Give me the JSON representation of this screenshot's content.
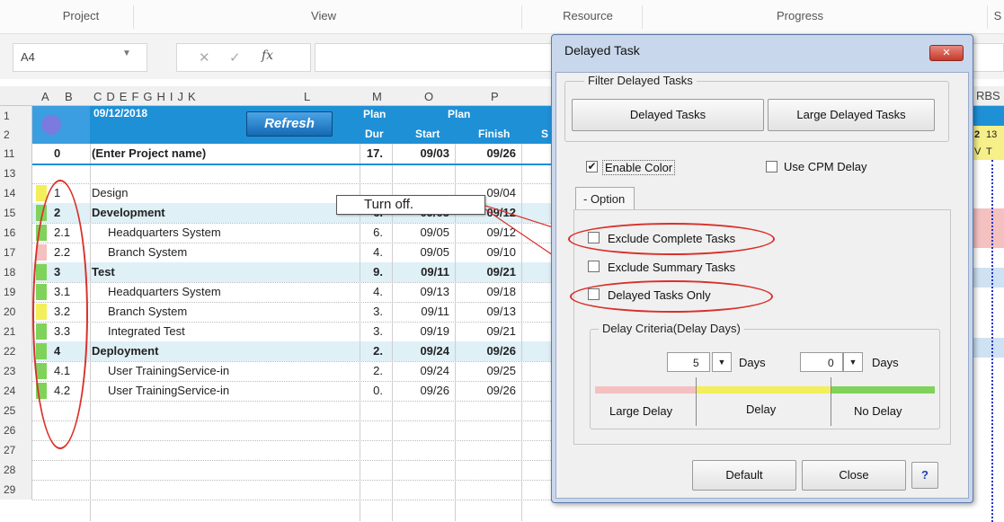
{
  "ribbon": {
    "groups": [
      "Project",
      "View",
      "Resource",
      "Progress",
      "S"
    ]
  },
  "formula_bar": {
    "name_box": "A4",
    "fx": "fx"
  },
  "columns": {
    "letters": [
      "A",
      "B",
      "C",
      "D",
      "E",
      "F",
      "G",
      "H",
      "I",
      "J",
      "K",
      "L",
      "M",
      "O",
      "P"
    ],
    "right": "RBS"
  },
  "header": {
    "date": "09/12/2018",
    "refresh": "Refresh",
    "plan_dur_top": "Plan",
    "plan_dur_bottom": "Dur",
    "plan_label": "Plan",
    "start_label": "Start",
    "finish_label": "Finish",
    "col_s": "S",
    "timeline_day": "2",
    "timeline_day2": "13",
    "timeline_wk": "V",
    "timeline_wk2": "T"
  },
  "rows": [
    {
      "num": "1",
      "task": "",
      "dur": "",
      "start": "",
      "finish": ""
    },
    {
      "num": "2",
      "task": "",
      "dur": "",
      "start": "",
      "finish": ""
    },
    {
      "num": "11",
      "id": "0",
      "task": "(Enter Project name)",
      "dur": "17.",
      "start": "09/03",
      "finish": "09/26",
      "bold": true
    },
    {
      "num": "13",
      "id": "",
      "task": "",
      "dur": "",
      "start": "",
      "finish": ""
    },
    {
      "num": "14",
      "id": "1",
      "task": "Design",
      "dur": "",
      "start": "",
      "finish": "09/04",
      "status": "yellow"
    },
    {
      "num": "15",
      "id": "2",
      "task": "Development",
      "dur": "6.",
      "start": "09/05",
      "finish": "09/12",
      "bold": true,
      "status": "green"
    },
    {
      "num": "16",
      "id": "2.1",
      "task": "Headquarters System",
      "dur": "6.",
      "start": "09/05",
      "finish": "09/12",
      "indent": true,
      "status": "green"
    },
    {
      "num": "17",
      "id": "2.2",
      "task": "Branch System",
      "dur": "4.",
      "start": "09/05",
      "finish": "09/10",
      "indent": true,
      "status": "pink"
    },
    {
      "num": "18",
      "id": "3",
      "task": "Test",
      "dur": "9.",
      "start": "09/11",
      "finish": "09/21",
      "bold": true,
      "status": "green"
    },
    {
      "num": "19",
      "id": "3.1",
      "task": "Headquarters System",
      "dur": "4.",
      "start": "09/13",
      "finish": "09/18",
      "indent": true,
      "status": "green"
    },
    {
      "num": "20",
      "id": "3.2",
      "task": "Branch System",
      "dur": "3.",
      "start": "09/11",
      "finish": "09/13",
      "indent": true,
      "status": "yellow"
    },
    {
      "num": "21",
      "id": "3.3",
      "task": "Integrated Test",
      "dur": "3.",
      "start": "09/19",
      "finish": "09/21",
      "indent": true,
      "status": "green"
    },
    {
      "num": "22",
      "id": "4",
      "task": "Deployment",
      "dur": "2.",
      "start": "09/24",
      "finish": "09/26",
      "bold": true,
      "status": "green"
    },
    {
      "num": "23",
      "id": "4.1",
      "task": "User TrainingService-in",
      "dur": "2.",
      "start": "09/24",
      "finish": "09/25",
      "indent": true,
      "status": "green"
    },
    {
      "num": "24",
      "id": "4.2",
      "task": "User TrainingService-in",
      "dur": "0.",
      "start": "09/26",
      "finish": "09/26",
      "indent": true,
      "status": "green"
    },
    {
      "num": "25"
    },
    {
      "num": "26"
    },
    {
      "num": "27"
    },
    {
      "num": "28"
    },
    {
      "num": "29"
    }
  ],
  "callout": {
    "text": "Turn off."
  },
  "dialog": {
    "title": "Delayed Task",
    "close_x": "✕",
    "filter_legend": "Filter Delayed Tasks",
    "btn_delayed": "Delayed Tasks",
    "btn_large": "Large Delayed Tasks",
    "enable_color": "Enable Color",
    "enable_color_checked": "✔",
    "use_cpm": "Use CPM Delay",
    "tab_option": "- Option",
    "exclude_complete": "Exclude Complete Tasks",
    "exclude_summary": "Exclude Summary Tasks",
    "delayed_only": "Delayed Tasks Only",
    "criteria_legend": "Delay Criteria(Delay Days)",
    "large_days_value": "5",
    "days_label": "Days",
    "small_days_value": "0",
    "days_label2": "Days",
    "large_delay": "Large Delay",
    "delay": "Delay",
    "no_delay": "No Delay",
    "btn_default": "Default",
    "btn_close": "Close",
    "btn_help": "?"
  },
  "colors": {
    "green": "#7fd35a",
    "yellow": "#f3ef5a",
    "pink": "#f4c0c0",
    "header_blue": "#1e90d6",
    "red": "#d9302a"
  }
}
